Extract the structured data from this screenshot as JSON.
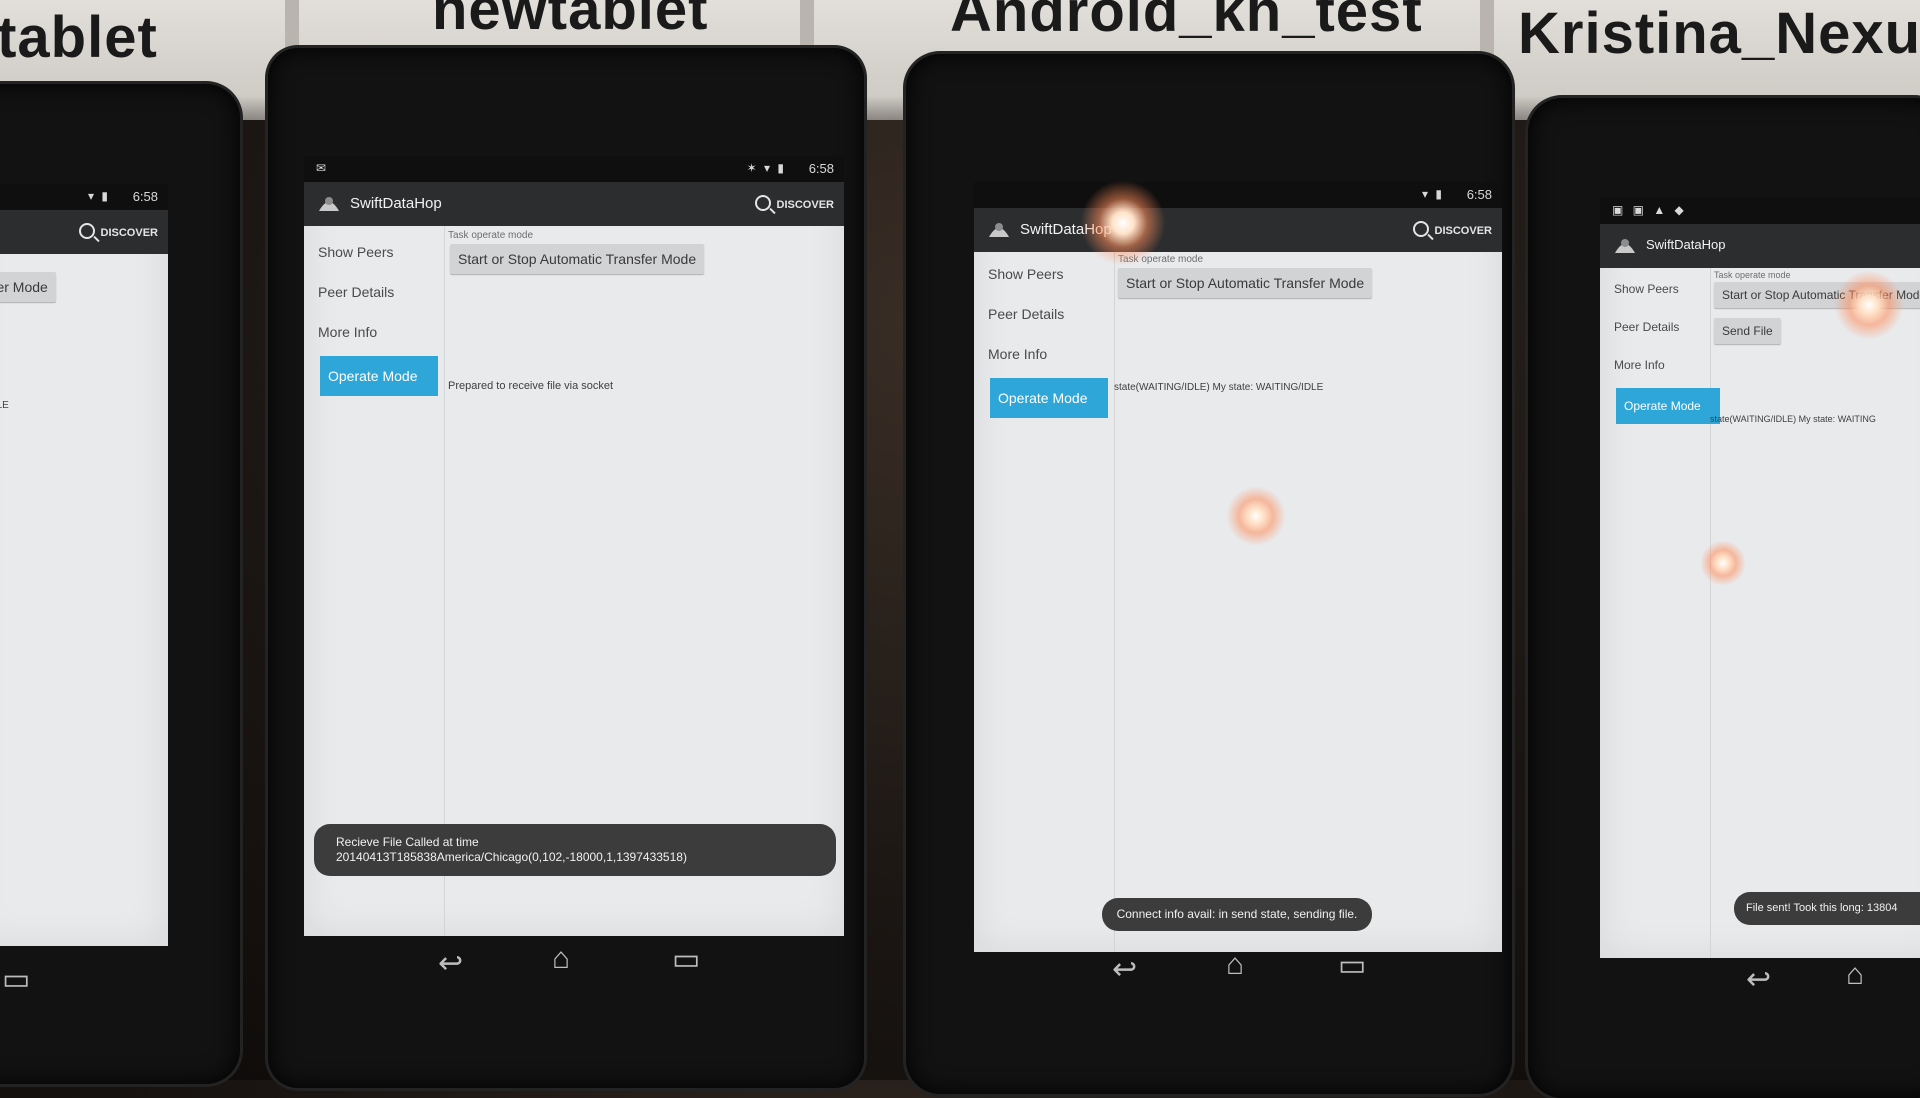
{
  "scene": {
    "labels": [
      "ltablet",
      "newtablet",
      "Android_kh_test",
      "Kristina_Nexus"
    ]
  },
  "app": {
    "name": "SwiftDataHop",
    "discover_label": "DISCOVER",
    "nav": [
      "Show Peers",
      "Peer Details",
      "More Info",
      "Operate Mode"
    ],
    "task_caption": "Task operate mode",
    "transfer_button": "Start or Stop Automatic Transfer Mode",
    "send_file_button": "Send File"
  },
  "devices": [
    {
      "time": "6:58",
      "button_fragment": "ansfer Mode",
      "state_fragment": "ING/IDLE"
    },
    {
      "time": "6:58",
      "state": "Prepared to receive file via socket",
      "toast": "Recieve File Called at time 20140413T185838America/Chicago(0,102,-18000,1,1397433518)"
    },
    {
      "time": "6:58",
      "state": "state(WAITING/IDLE) My state: WAITING/IDLE",
      "toast": "Connect info avail: in send state, sending file."
    },
    {
      "state": "state(WAITING/IDLE) My state: WAITING",
      "toast": "File sent! Took this long: 13804"
    }
  ],
  "colors": {
    "active_nav": "#2ea6d8",
    "action_bar": "#2b2d2f",
    "screen": "#e9eaec"
  },
  "icons": [
    "search-icon",
    "wifi-icon",
    "battery-icon",
    "back-icon",
    "home-icon",
    "recents-icon",
    "app-logo-icon"
  ]
}
